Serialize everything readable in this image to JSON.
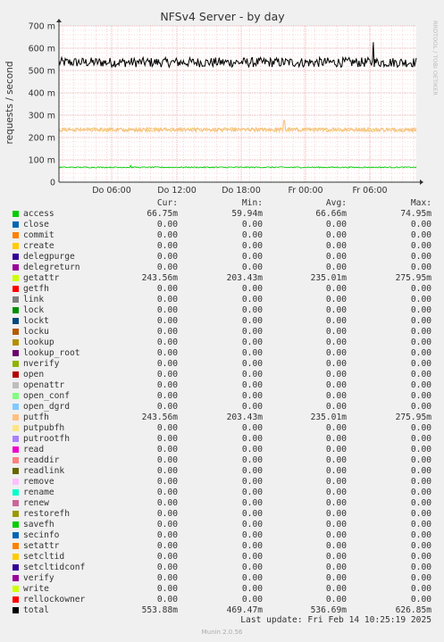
{
  "title": "NFSv4 Server - by day",
  "ylabel": "requests / second",
  "watermark": "RRDTOOL / TOBI OETIKER",
  "chart_data": {
    "type": "line",
    "title": "NFSv4 Server - by day",
    "ylabel": "requests / second",
    "ylim": [
      0,
      700
    ],
    "yticks": [
      "0",
      "100 m",
      "200 m",
      "300 m",
      "400 m",
      "500 m",
      "600 m",
      "700 m"
    ],
    "yticks_values": [
      0,
      100,
      200,
      300,
      400,
      500,
      600,
      700
    ],
    "xticks": [
      "Do 06:00",
      "Do 12:00",
      "Do 18:00",
      "Fr 00:00",
      "Fr 06:00"
    ],
    "grid": true,
    "series": [
      {
        "name": "total",
        "color": "#000000",
        "mean": 536.69,
        "min": 469.47,
        "max": 626.85,
        "noise": 22,
        "spike_at": 0.88
      },
      {
        "name": "getattr",
        "color": "#f0c860",
        "mean": 235.01,
        "min": 203.43,
        "max": 275.95,
        "noise": 9,
        "spike_at": 0.63
      },
      {
        "name": "putfh",
        "color": "#f8c088",
        "mean": 235.01,
        "min": 203.43,
        "max": 275.95,
        "noise": 9,
        "spike_at": 0.63
      },
      {
        "name": "access",
        "color": "#00cc00",
        "mean": 66.66,
        "min": 59.94,
        "max": 74.95,
        "noise": 2.5,
        "spike_at": 0.2
      }
    ]
  },
  "legend": {
    "headers": [
      "Cur:",
      "Min:",
      "Avg:",
      "Max:"
    ],
    "rows": [
      {
        "name": "access",
        "color": "#00cc00",
        "cur": "66.75m",
        "min": "59.94m",
        "avg": "66.66m",
        "max": "74.95m"
      },
      {
        "name": "close",
        "color": "#0066b3",
        "cur": "0.00",
        "min": "0.00",
        "avg": "0.00",
        "max": "0.00"
      },
      {
        "name": "commit",
        "color": "#ff8000",
        "cur": "0.00",
        "min": "0.00",
        "avg": "0.00",
        "max": "0.00"
      },
      {
        "name": "create",
        "color": "#ffcc00",
        "cur": "0.00",
        "min": "0.00",
        "avg": "0.00",
        "max": "0.00"
      },
      {
        "name": "delegpurge",
        "color": "#330099",
        "cur": "0.00",
        "min": "0.00",
        "avg": "0.00",
        "max": "0.00"
      },
      {
        "name": "delegreturn",
        "color": "#990099",
        "cur": "0.00",
        "min": "0.00",
        "avg": "0.00",
        "max": "0.00"
      },
      {
        "name": "getattr",
        "color": "#ccff00",
        "cur": "243.56m",
        "min": "203.43m",
        "avg": "235.01m",
        "max": "275.95m"
      },
      {
        "name": "getfh",
        "color": "#ff0000",
        "cur": "0.00",
        "min": "0.00",
        "avg": "0.00",
        "max": "0.00"
      },
      {
        "name": "link",
        "color": "#808080",
        "cur": "0.00",
        "min": "0.00",
        "avg": "0.00",
        "max": "0.00"
      },
      {
        "name": "lock",
        "color": "#008f00",
        "cur": "0.00",
        "min": "0.00",
        "avg": "0.00",
        "max": "0.00"
      },
      {
        "name": "lockt",
        "color": "#00487d",
        "cur": "0.00",
        "min": "0.00",
        "avg": "0.00",
        "max": "0.00"
      },
      {
        "name": "locku",
        "color": "#b35a00",
        "cur": "0.00",
        "min": "0.00",
        "avg": "0.00",
        "max": "0.00"
      },
      {
        "name": "lookup",
        "color": "#b38f00",
        "cur": "0.00",
        "min": "0.00",
        "avg": "0.00",
        "max": "0.00"
      },
      {
        "name": "lookup_root",
        "color": "#6b006b",
        "cur": "0.00",
        "min": "0.00",
        "avg": "0.00",
        "max": "0.00"
      },
      {
        "name": "nverify",
        "color": "#8fb300",
        "cur": "0.00",
        "min": "0.00",
        "avg": "0.00",
        "max": "0.00"
      },
      {
        "name": "open",
        "color": "#b30000",
        "cur": "0.00",
        "min": "0.00",
        "avg": "0.00",
        "max": "0.00"
      },
      {
        "name": "openattr",
        "color": "#bebebe",
        "cur": "0.00",
        "min": "0.00",
        "avg": "0.00",
        "max": "0.00"
      },
      {
        "name": "open_conf",
        "color": "#80ff80",
        "cur": "0.00",
        "min": "0.00",
        "avg": "0.00",
        "max": "0.00"
      },
      {
        "name": "open_dgrd",
        "color": "#80c9ff",
        "cur": "0.00",
        "min": "0.00",
        "avg": "0.00",
        "max": "0.00"
      },
      {
        "name": "putfh",
        "color": "#ffc080",
        "cur": "243.56m",
        "min": "203.43m",
        "avg": "235.01m",
        "max": "275.95m"
      },
      {
        "name": "putpubfh",
        "color": "#ffe680",
        "cur": "0.00",
        "min": "0.00",
        "avg": "0.00",
        "max": "0.00"
      },
      {
        "name": "putrootfh",
        "color": "#aa80ff",
        "cur": "0.00",
        "min": "0.00",
        "avg": "0.00",
        "max": "0.00"
      },
      {
        "name": "read",
        "color": "#ee00cc",
        "cur": "0.00",
        "min": "0.00",
        "avg": "0.00",
        "max": "0.00"
      },
      {
        "name": "readdir",
        "color": "#ff8080",
        "cur": "0.00",
        "min": "0.00",
        "avg": "0.00",
        "max": "0.00"
      },
      {
        "name": "readlink",
        "color": "#666600",
        "cur": "0.00",
        "min": "0.00",
        "avg": "0.00",
        "max": "0.00"
      },
      {
        "name": "remove",
        "color": "#ffbfff",
        "cur": "0.00",
        "min": "0.00",
        "avg": "0.00",
        "max": "0.00"
      },
      {
        "name": "rename",
        "color": "#00ffcc",
        "cur": "0.00",
        "min": "0.00",
        "avg": "0.00",
        "max": "0.00"
      },
      {
        "name": "renew",
        "color": "#cc6699",
        "cur": "0.00",
        "min": "0.00",
        "avg": "0.00",
        "max": "0.00"
      },
      {
        "name": "restorefh",
        "color": "#999900",
        "cur": "0.00",
        "min": "0.00",
        "avg": "0.00",
        "max": "0.00"
      },
      {
        "name": "savefh",
        "color": "#00cc00",
        "cur": "0.00",
        "min": "0.00",
        "avg": "0.00",
        "max": "0.00"
      },
      {
        "name": "secinfo",
        "color": "#0066b3",
        "cur": "0.00",
        "min": "0.00",
        "avg": "0.00",
        "max": "0.00"
      },
      {
        "name": "setattr",
        "color": "#ff8000",
        "cur": "0.00",
        "min": "0.00",
        "avg": "0.00",
        "max": "0.00"
      },
      {
        "name": "setcltid",
        "color": "#ffcc00",
        "cur": "0.00",
        "min": "0.00",
        "avg": "0.00",
        "max": "0.00"
      },
      {
        "name": "setcltidconf",
        "color": "#330099",
        "cur": "0.00",
        "min": "0.00",
        "avg": "0.00",
        "max": "0.00"
      },
      {
        "name": "verify",
        "color": "#990099",
        "cur": "0.00",
        "min": "0.00",
        "avg": "0.00",
        "max": "0.00"
      },
      {
        "name": "write",
        "color": "#ccff00",
        "cur": "0.00",
        "min": "0.00",
        "avg": "0.00",
        "max": "0.00"
      },
      {
        "name": "rellockowner",
        "color": "#ff0000",
        "cur": "0.00",
        "min": "0.00",
        "avg": "0.00",
        "max": "0.00"
      },
      {
        "name": "total",
        "color": "#000000",
        "cur": "553.88m",
        "min": "469.47m",
        "avg": "536.69m",
        "max": "626.85m"
      }
    ]
  },
  "last_update": "Last update:  Fri Feb 14 10:25:19 2025",
  "footer": "Munin 2.0.56"
}
